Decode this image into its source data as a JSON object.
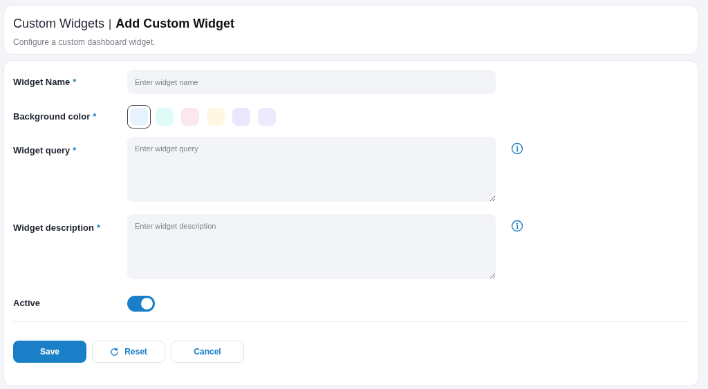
{
  "header": {
    "breadcrumb_parent": "Custom Widgets",
    "separator": "|",
    "title": "Add Custom Widget",
    "subtitle": "Configure a custom dashboard widget."
  },
  "fields": [
    {
      "kind": "text",
      "label": "Widget Name",
      "required_mark": "*",
      "placeholder": "Enter widget name"
    },
    {
      "kind": "swatches",
      "label": "Background color",
      "required_mark": "*",
      "swatches": [
        {
          "color": "#e6f3ff",
          "selected": true
        },
        {
          "color": "#e0fbf7",
          "selected": false
        },
        {
          "color": "#fde7ee",
          "selected": false
        },
        {
          "color": "#fff7e3",
          "selected": false
        },
        {
          "color": "#ece6fe",
          "selected": false
        },
        {
          "color": "#ebebfd",
          "selected": false
        }
      ]
    },
    {
      "kind": "textarea",
      "label": "Widget query",
      "required_mark": "*",
      "placeholder": "Enter widget query"
    },
    {
      "kind": "textarea",
      "label": "Widget description",
      "required_mark": "*",
      "placeholder": "Enter widget description"
    },
    {
      "kind": "toggle",
      "label": "Active",
      "on": true
    }
  ],
  "buttons": [
    {
      "kind": "primary",
      "label": "Save"
    },
    {
      "kind": "reset",
      "label": "Reset"
    },
    {
      "kind": "secondary",
      "label": "Cancel"
    }
  ]
}
